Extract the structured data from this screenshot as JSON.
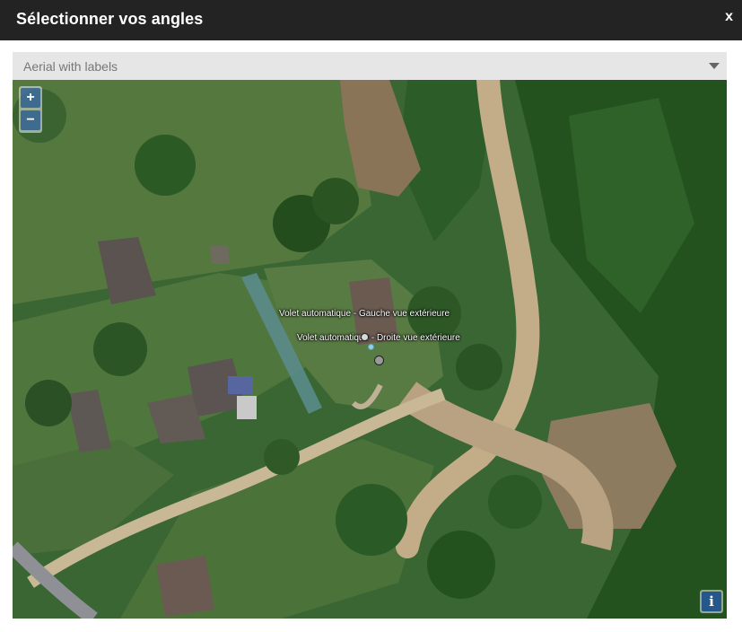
{
  "header": {
    "title": "Sélectionner vos angles",
    "close_label": "x"
  },
  "layer_select": {
    "value": "Aerial with labels"
  },
  "map": {
    "zoom_in_label": "+",
    "zoom_out_label": "−",
    "info_label": "i",
    "markers": [
      {
        "label": "Volet automatique - Gauche vue extérieure",
        "color": "#d8d8d8"
      },
      {
        "label": "Volet automatique - Droite vue extérieure",
        "color": "#9a9a9a"
      }
    ]
  }
}
